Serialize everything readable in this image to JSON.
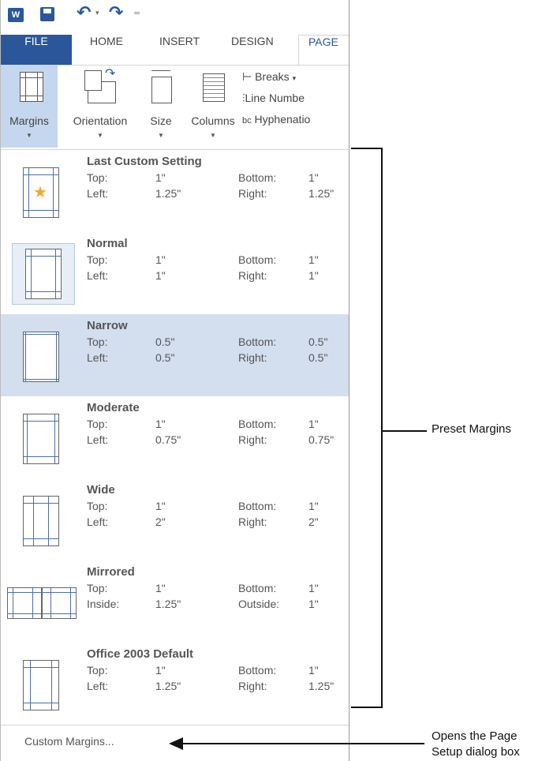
{
  "qat": {
    "app_badge": "W"
  },
  "tabs": [
    {
      "label": "FILE"
    },
    {
      "label": "HOME"
    },
    {
      "label": "INSERT"
    },
    {
      "label": "DESIGN"
    },
    {
      "label": "PAGE"
    }
  ],
  "ribbon": {
    "margins": "Margins",
    "orientation": "Orientation",
    "size": "Size",
    "columns": "Columns",
    "breaks": "Breaks",
    "line_numbers": "Line Numbe",
    "hyphenation": "Hyphenatio"
  },
  "presets": [
    {
      "name": "Last Custom Setting",
      "l1": "Top:",
      "v1": "1\"",
      "l2": "Bottom:",
      "v2": "1\"",
      "l3": "Left:",
      "v3": "1.25\"",
      "l4": "Right:",
      "v4": "1.25\""
    },
    {
      "name": "Normal",
      "l1": "Top:",
      "v1": "1\"",
      "l2": "Bottom:",
      "v2": "1\"",
      "l3": "Left:",
      "v3": "1\"",
      "l4": "Right:",
      "v4": "1\""
    },
    {
      "name": "Narrow",
      "l1": "Top:",
      "v1": "0.5\"",
      "l2": "Bottom:",
      "v2": "0.5\"",
      "l3": "Left:",
      "v3": "0.5\"",
      "l4": "Right:",
      "v4": "0.5\""
    },
    {
      "name": "Moderate",
      "l1": "Top:",
      "v1": "1\"",
      "l2": "Bottom:",
      "v2": "1\"",
      "l3": "Left:",
      "v3": "0.75\"",
      "l4": "Right:",
      "v4": "0.75\""
    },
    {
      "name": "Wide",
      "l1": "Top:",
      "v1": "1\"",
      "l2": "Bottom:",
      "v2": "1\"",
      "l3": "Left:",
      "v3": "2\"",
      "l4": "Right:",
      "v4": "2\""
    },
    {
      "name": "Mirrored",
      "l1": "Top:",
      "v1": "1\"",
      "l2": "Bottom:",
      "v2": "1\"",
      "l3": "Inside:",
      "v3": "1.25\"",
      "l4": "Outside:",
      "v4": "1\""
    },
    {
      "name": "Office 2003 Default",
      "l1": "Top:",
      "v1": "1\"",
      "l2": "Bottom:",
      "v2": "1\"",
      "l3": "Left:",
      "v3": "1.25\"",
      "l4": "Right:",
      "v4": "1.25\""
    }
  ],
  "footer": {
    "custom_margins": "Custom Margins..."
  },
  "callouts": {
    "preset_margins": "Preset Margins",
    "opens_line1": "Opens the Page",
    "opens_line2": "Setup dialog box"
  },
  "colors": {
    "accent": "#2b579a",
    "selected": "#d3deef",
    "star": "#f0a92e"
  }
}
